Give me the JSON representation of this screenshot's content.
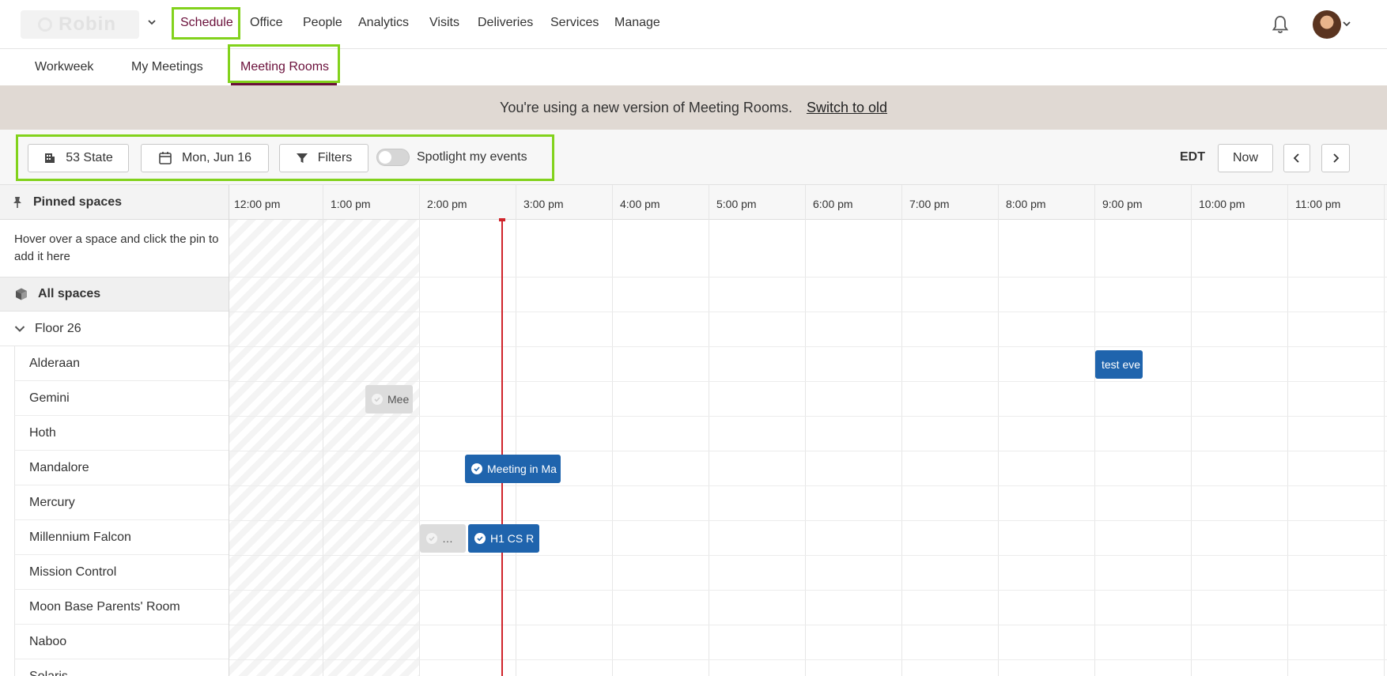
{
  "app": {
    "logo_text": "Robin"
  },
  "nav": {
    "items": [
      {
        "label": "Schedule",
        "active": true
      },
      {
        "label": "Office"
      },
      {
        "label": "People"
      },
      {
        "label": "Analytics"
      },
      {
        "label": "Visits"
      },
      {
        "label": "Deliveries"
      },
      {
        "label": "Services"
      },
      {
        "label": "Manage"
      }
    ]
  },
  "subnav": {
    "tabs": [
      {
        "label": "Workweek"
      },
      {
        "label": "My Meetings"
      },
      {
        "label": "Meeting Rooms",
        "active": true
      }
    ]
  },
  "banner": {
    "text": "You're using a new version of Meeting Rooms.",
    "link": "Switch to old"
  },
  "toolbar": {
    "location": "53 State",
    "date": "Mon, Jun 16",
    "filters": "Filters",
    "spotlight_label": "Spotlight my events",
    "spotlight_on": false,
    "timezone": "EDT",
    "now_label": "Now"
  },
  "sidebar": {
    "pinned_header": "Pinned spaces",
    "pinned_hint": "Hover over a space and click the pin to add it here",
    "all_spaces": "All spaces",
    "floor": "Floor 26",
    "rooms": [
      "Alderaan",
      "Gemini",
      "Hoth",
      "Mandalore",
      "Mercury",
      "Millennium Falcon",
      "Mission Control",
      "Moon Base Parents' Room",
      "Naboo",
      "Solaris"
    ]
  },
  "timeline": {
    "hours": [
      "12:00 pm",
      "1:00 pm",
      "2:00 pm",
      "3:00 pm",
      "4:00 pm",
      "5:00 pm",
      "6:00 pm",
      "7:00 pm",
      "8:00 pm",
      "9:00 pm",
      "10:00 pm",
      "11:00 pm"
    ],
    "events": [
      {
        "room": "Alderaan",
        "label": "test eve",
        "checked": false,
        "style": "blue"
      },
      {
        "room": "Gemini",
        "label": "Mee",
        "checked": true,
        "style": "gray"
      },
      {
        "room": "Mandalore",
        "label": "Meeting in Ma",
        "checked": true,
        "style": "blue"
      },
      {
        "room": "Millennium Falcon",
        "label": "…",
        "checked": true,
        "style": "gray"
      },
      {
        "room": "Millennium Falcon",
        "label": "H1 CS R",
        "checked": true,
        "style": "blue"
      }
    ]
  },
  "colors": {
    "accent": "#6a0f3a",
    "highlight": "#82d21c",
    "event_blue": "#1f64ad",
    "now_line": "#d0242b"
  }
}
